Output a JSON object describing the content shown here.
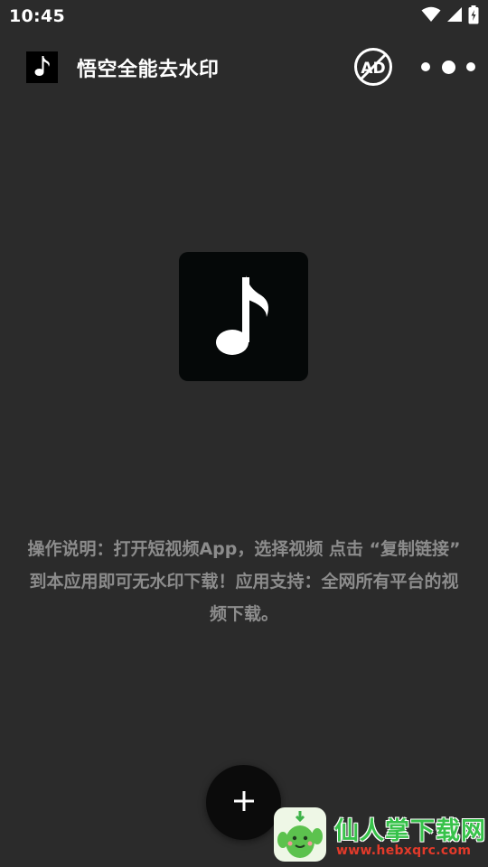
{
  "status_bar": {
    "time": "10:45",
    "icons": [
      "wifi-icon",
      "signal-icon",
      "battery-icon"
    ]
  },
  "app_bar": {
    "title": "悟空全能去水印",
    "app_icon": "music-note-icon",
    "no_ad_label": "AD",
    "more_icon": "more-dots-icon"
  },
  "main": {
    "logo_icon": "music-note-icon",
    "instructions": "操作说明：打开短视频App，选择视频 点击 “复制链接” 到本应用即可无水印下载！应用支持：全网所有平台的视频下载。"
  },
  "fab": {
    "label": "+",
    "icon": "plus-icon"
  },
  "watermark": {
    "title": "仙人掌下载网",
    "url": "www.hebxqrc.com"
  },
  "colors": {
    "background": "#2b2b2b",
    "text_primary": "#ffffff",
    "text_secondary": "#8c8c8c",
    "logo_bg": "#050808",
    "watermark_green": "#37c24a",
    "watermark_red": "#e33a2a"
  }
}
